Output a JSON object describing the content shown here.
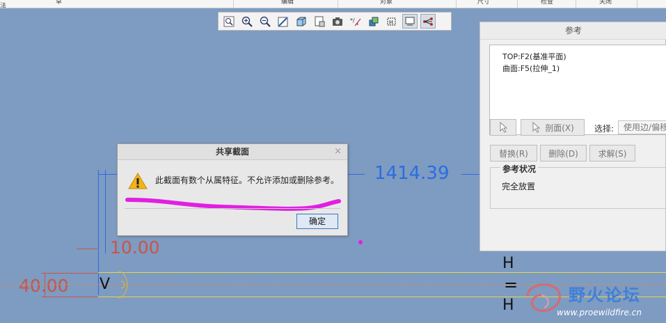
{
  "menu_bar": {
    "items": [
      "草法",
      "编辑",
      "对象",
      "尺寸",
      "检查",
      "关闭"
    ]
  },
  "view_toolbar": {
    "buttons": [
      {
        "icon": "zoom-fit-icon",
        "active": false
      },
      {
        "icon": "zoom-in-icon",
        "active": false
      },
      {
        "icon": "zoom-out-icon",
        "active": false
      },
      {
        "icon": "repaint-icon",
        "active": false
      },
      {
        "icon": "display-style-icon",
        "active": false
      },
      {
        "icon": "saved-orientations-icon",
        "active": false
      },
      {
        "icon": "view-manager-icon",
        "active": false
      },
      {
        "icon": "datum-display-icon",
        "active": false
      },
      {
        "icon": "annotation-display-icon",
        "active": false
      },
      {
        "icon": "sketch-view-icon",
        "active": false
      },
      {
        "icon": "constraint-display-icon",
        "active": true
      },
      {
        "icon": "vertex-display-icon",
        "active": true
      }
    ]
  },
  "sketch": {
    "dim_width": "1414.39",
    "dim_offset": "10.00",
    "dim_height": "40.00",
    "constraint_v": "V",
    "constraint_h_top": "H",
    "constraint_eq": "=",
    "constraint_h_bottom": "H"
  },
  "references_panel": {
    "title": "参考",
    "references": [
      "TOP:F2(基准平面)",
      "曲面:F5(拉伸_1)"
    ],
    "section_button": "剖面(X)",
    "select_label": "选择:",
    "select_value": "使用边/偏移",
    "replace_button": "替换(R)",
    "delete_button": "删除(D)",
    "solve_button": "求解(S)",
    "status_group_title": "参考状况",
    "status_value": "完全放置"
  },
  "dialog": {
    "title": "共享截面",
    "close_glyph": "×",
    "message": "此截面有数个从属特征。不允许添加或删除参考。",
    "ok_button": "确定"
  },
  "watermark": {
    "site_name": "野火论坛",
    "url": "www.proewildfire.cn"
  },
  "colors": {
    "canvas": "#7e9bc1",
    "dimension_blue": "#2a6de0",
    "dimension_red": "#c9544a",
    "sketch_yellow": "#e6d64a",
    "highlight_magenta": "#e020e0"
  }
}
